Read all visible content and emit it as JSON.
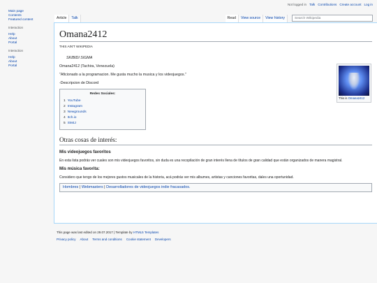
{
  "personal": {
    "not_logged_in": "Not logged in",
    "talk": "Talk",
    "contributions": "Contributions",
    "create_account": "Create account",
    "login": "Log in"
  },
  "sidebar": {
    "nav": [
      "Main page",
      "Contents",
      "Featured content"
    ],
    "interaction1": {
      "heading": "Interaction",
      "items": [
        "Help",
        "About",
        "Portal"
      ]
    },
    "interaction2": {
      "heading": "Interaction",
      "items": [
        "Help",
        "About",
        "Portal"
      ]
    }
  },
  "tabs": {
    "left": [
      "Article",
      "Talk"
    ],
    "right": [
      "Read",
      "View source",
      "View history"
    ]
  },
  "search": {
    "placeholder": "Search Wikipedia"
  },
  "article": {
    "title": "Omana2412",
    "site_sub": "THIS AIN'T WIKIPEDIA",
    "italic_line": "SKIBIDI SIGMA",
    "location": "Omana2412 (Tachira, Venezuela)",
    "quote": "\"Aficionado a la programacion. Me gusta mucho la musica y los videojuegos.\"",
    "discord": "-Descripcion de Discord",
    "thumb_caption_prefix": "This is",
    "thumb_caption_link": "Omana2412",
    "toc": {
      "title": "Redes Sociales:",
      "items": [
        {
          "num": "1",
          "label": "YouTube"
        },
        {
          "num": "2",
          "label": "Instagram"
        },
        {
          "num": "3",
          "label": "Newgrounds"
        },
        {
          "num": "4",
          "label": "Itch.io"
        },
        {
          "num": "5",
          "label": "SM4J"
        }
      ]
    },
    "section_heading": "Otras cosas de interés:",
    "games_heading": "Mis videojuegos favoritos",
    "games_text": "En esta lista podrás ver cuales son mis videojuegos favoritos, sin duda es una recopilación de gran interés llena de títulos de gran calidad que están organizados de manera magistral.",
    "music_heading": "Mis música favorita:",
    "music_text": "Considero que tengo de los mejores gustos musicales de la historia, acá podrás ver mis albumes, artistas y canciones favoritas, dales una oportunidad.",
    "navbox": [
      "Hombres",
      "Webmasters",
      "Desarrolladores de videojuegos indie fracasados."
    ]
  },
  "footer": {
    "lastmod_prefix": "This page was last edited on 29.07.2017 | Template by",
    "lastmod_link": "HTML5 Templates",
    "links": [
      "Privacy policy",
      "About",
      "Terms and conditions",
      "Cookie statement",
      "Developers"
    ]
  }
}
